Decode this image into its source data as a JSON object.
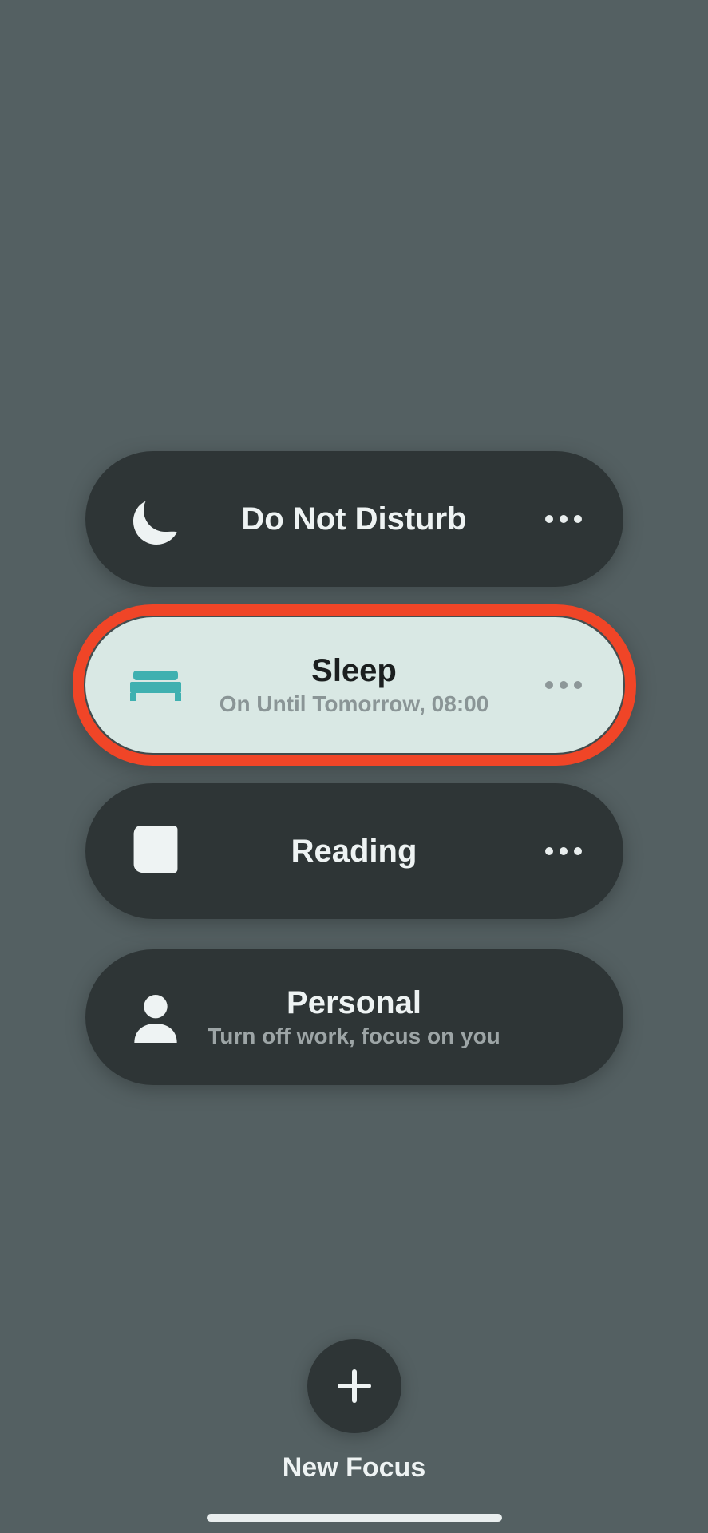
{
  "focus_modes": [
    {
      "id": "dnd",
      "label": "Do Not Disturb",
      "subtitle": "",
      "icon": "moon-icon",
      "active": false,
      "has_more": true,
      "highlighted": false
    },
    {
      "id": "sleep",
      "label": "Sleep",
      "subtitle": "On Until Tomorrow, 08:00",
      "icon": "bed-icon",
      "active": true,
      "has_more": true,
      "highlighted": true
    },
    {
      "id": "reading",
      "label": "Reading",
      "subtitle": "",
      "icon": "book-icon",
      "active": false,
      "has_more": true,
      "highlighted": false
    },
    {
      "id": "personal",
      "label": "Personal",
      "subtitle": "Turn off work, focus on you",
      "icon": "person-icon",
      "active": false,
      "has_more": false,
      "highlighted": false
    }
  ],
  "new_focus": {
    "label": "New Focus"
  }
}
